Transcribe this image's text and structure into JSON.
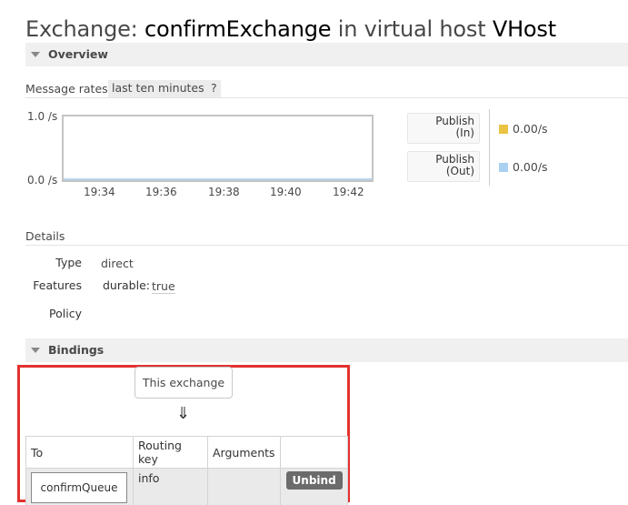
{
  "title": {
    "prefix": "Exchange: ",
    "name": "confirmExchange",
    "middle": " in virtual host ",
    "vhost": "VHost"
  },
  "sections": {
    "overview": "Overview",
    "bindings": "Bindings"
  },
  "rates": {
    "label": "Message rates",
    "range": "last ten minutes",
    "help": "?"
  },
  "chart_data": {
    "type": "line",
    "x": [
      "19:34",
      "19:36",
      "19:38",
      "19:40",
      "19:42"
    ],
    "y_ticks": [
      "0.0 /s",
      "1.0 /s"
    ],
    "ylim": [
      0,
      1
    ],
    "series": [
      {
        "name": "Publish (In)",
        "color": "#ebc343",
        "values": [
          0,
          0,
          0,
          0,
          0
        ]
      },
      {
        "name": "Publish (Out)",
        "color": "#aad0f2",
        "values": [
          0,
          0,
          0,
          0,
          0
        ]
      }
    ]
  },
  "legend": [
    {
      "line1": "Publish",
      "line2": "(In)",
      "value": "0.00/s",
      "color": "#ebc343"
    },
    {
      "line1": "Publish",
      "line2": "(Out)",
      "value": "0.00/s",
      "color": "#aad0f2"
    }
  ],
  "details": {
    "heading": "Details",
    "type_label": "Type",
    "type_value": "direct",
    "features_label": "Features",
    "durable_label": "durable:",
    "durable_value": "true",
    "policy_label": "Policy"
  },
  "bindings": {
    "source": "This exchange",
    "arrow": "⇓",
    "columns": [
      "To",
      "Routing key",
      "Arguments",
      ""
    ],
    "rows": [
      {
        "to": "confirmQueue",
        "routing_key": "info",
        "arguments": "",
        "action": "Unbind"
      }
    ]
  },
  "colors": {
    "frame": "#e3312f"
  }
}
